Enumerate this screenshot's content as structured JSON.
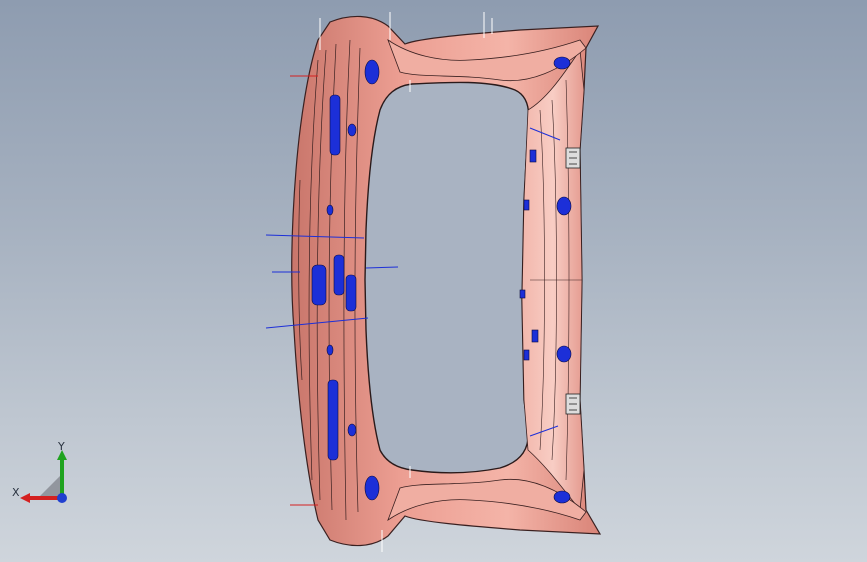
{
  "viewport": {
    "model": "tailgate-inner-panel",
    "part_color": "#e89a8e",
    "part_shadow": "#c76d62",
    "hole_color": "#1c2fd8",
    "edge_color": "#2a1a1a"
  },
  "triad": {
    "x_label": "X",
    "y_label": "Y",
    "x_color": "#d42020",
    "y_color": "#1fa31f",
    "z_color": "#2040d0"
  }
}
